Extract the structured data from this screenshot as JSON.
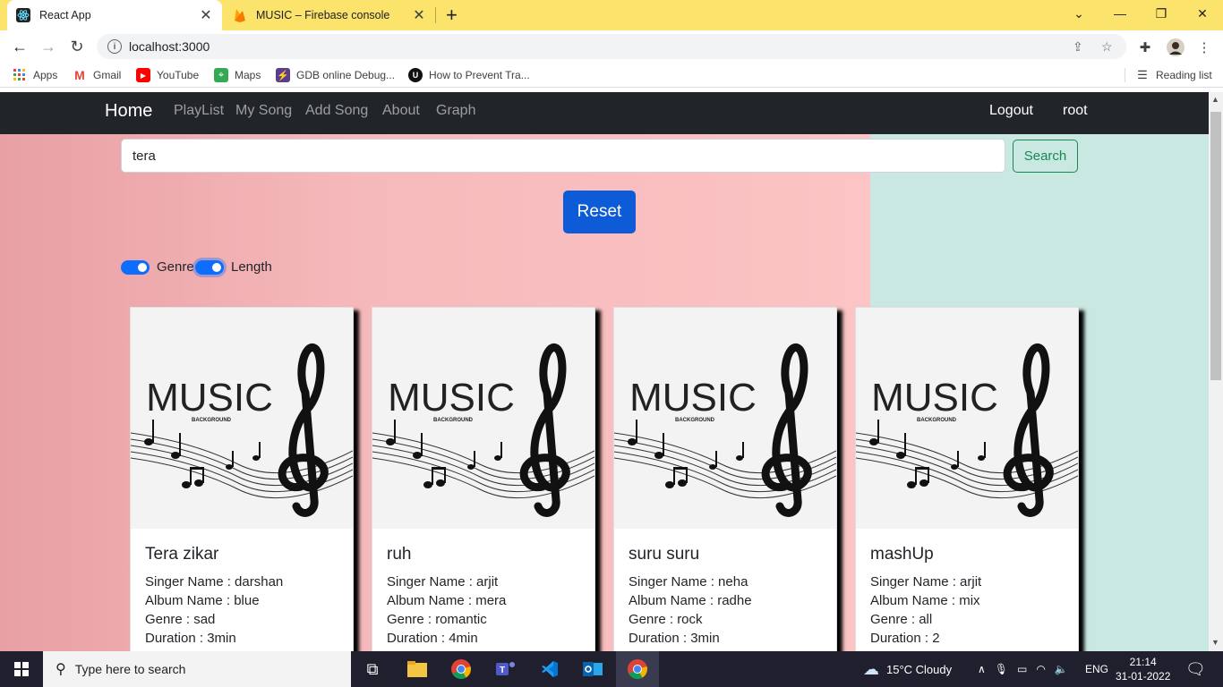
{
  "browser": {
    "tabs": [
      {
        "title": "React App",
        "active": true
      },
      {
        "title": "MUSIC – Firebase console",
        "active": false
      }
    ],
    "url": "localhost:3000",
    "bookmarks": [
      "Apps",
      "Gmail",
      "YouTube",
      "Maps",
      "GDB online Debug...",
      "How to Prevent Tra..."
    ],
    "reading_list": "Reading list"
  },
  "navbar": {
    "brand": "Home",
    "links": [
      "PlayList",
      "My Song",
      "Add Song",
      "About",
      "Graph"
    ],
    "logout": "Logout",
    "user": "root"
  },
  "search": {
    "value": "tera",
    "button": "Search"
  },
  "reset_label": "Reset",
  "filters": [
    {
      "label": "Genre",
      "checked": true
    },
    {
      "label": "Length",
      "checked": true
    }
  ],
  "cards": [
    {
      "title": "Tera zikar",
      "singer": "Singer Name : darshan",
      "album": "Album Name : blue",
      "genre": "Genre : sad",
      "duration": "Duration : 3min"
    },
    {
      "title": "ruh",
      "singer": "Singer Name : arjit",
      "album": "Album Name : mera",
      "genre": "Genre : romantic",
      "duration": "Duration : 4min"
    },
    {
      "title": "suru suru",
      "singer": "Singer Name : neha",
      "album": "Album Name : radhe",
      "genre": "Genre : rock",
      "duration": "Duration : 3min"
    },
    {
      "title": "mashUp",
      "singer": "Singer Name : arjit",
      "album": "Album Name : mix",
      "genre": "Genre : all",
      "duration": "Duration : 2"
    }
  ],
  "card_image": {
    "word": "MUSIC",
    "sub": "BACKGROUND"
  },
  "taskbar": {
    "search_placeholder": "Type here to search",
    "weather": "15°C  Cloudy",
    "lang": "ENG",
    "time": "21:14",
    "date": "31-01-2022"
  }
}
